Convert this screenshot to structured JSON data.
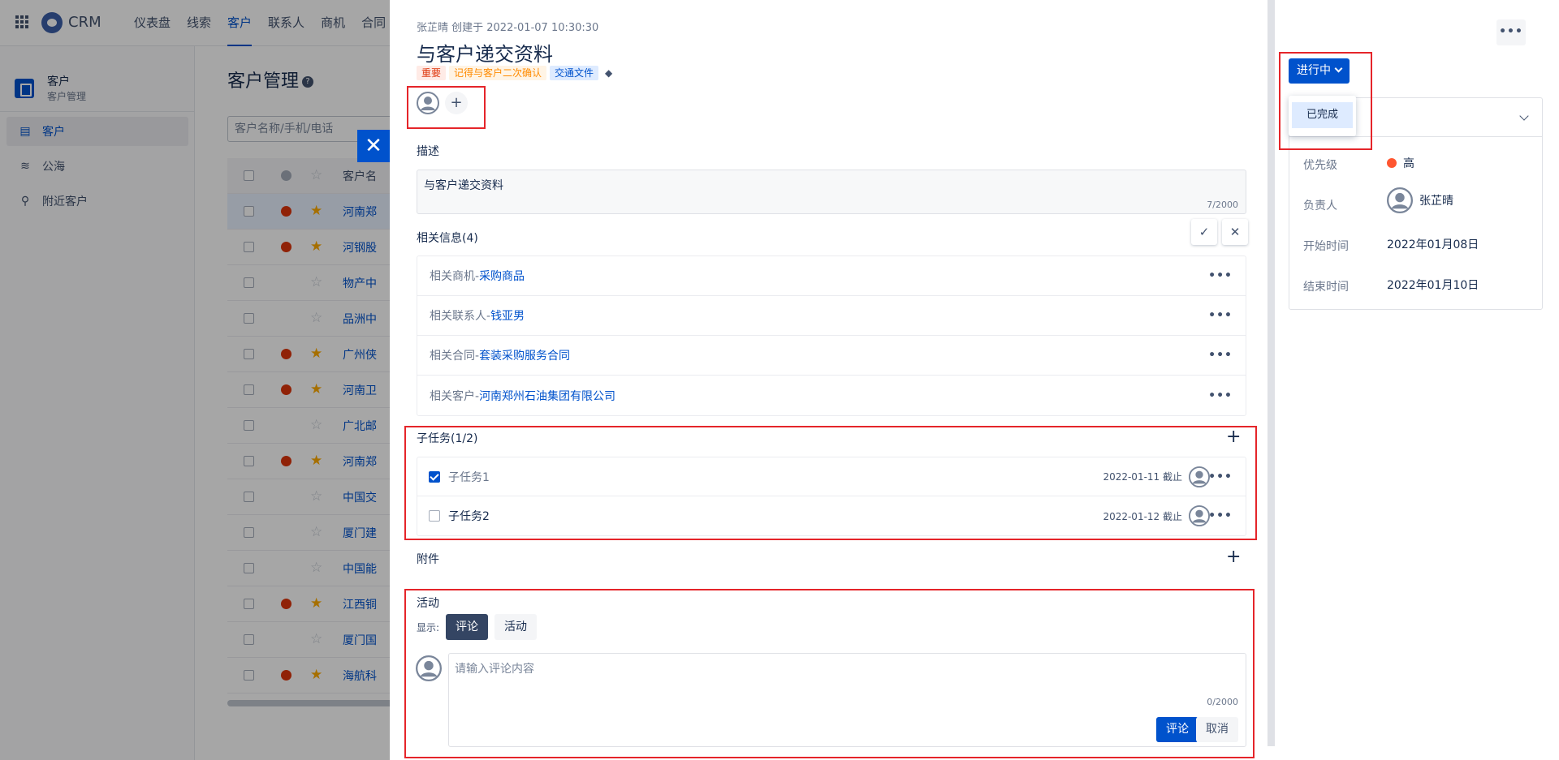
{
  "app": {
    "brand": "CRM",
    "nav": [
      "仪表盘",
      "线索",
      "客户",
      "联系人",
      "商机",
      "合同"
    ],
    "active_nav": 2
  },
  "sidebar": {
    "module_title": "客户",
    "module_subtitle": "客户管理",
    "items": [
      {
        "label": "客户",
        "icon": "building-icon"
      },
      {
        "label": "公海",
        "icon": "waves-icon"
      },
      {
        "label": "附近客户",
        "icon": "location-pin-icon"
      }
    ]
  },
  "main": {
    "title": "客户管理",
    "search_placeholder": "客户名称/手机/电话",
    "name_header": "客户名",
    "rows": [
      {
        "name": "河南郑",
        "dot": true,
        "star": true,
        "selected": true
      },
      {
        "name": "河钢股",
        "dot": true,
        "star": true
      },
      {
        "name": "物产中",
        "dot": false,
        "star": false
      },
      {
        "name": "品洲中",
        "dot": false,
        "star": false
      },
      {
        "name": "广州侠",
        "dot": true,
        "star": true
      },
      {
        "name": "河南卫",
        "dot": true,
        "star": true
      },
      {
        "name": "广北邮",
        "dot": false,
        "star": false
      },
      {
        "name": "河南郑",
        "dot": true,
        "star": true
      },
      {
        "name": "中国交",
        "dot": false,
        "star": false
      },
      {
        "name": "厦门建",
        "dot": false,
        "star": false
      },
      {
        "name": "中国能",
        "dot": false,
        "star": false
      },
      {
        "name": "江西铜",
        "dot": true,
        "star": true
      },
      {
        "name": "厦门国",
        "dot": false,
        "star": false
      },
      {
        "name": "海航科",
        "dot": true,
        "star": true
      }
    ]
  },
  "task": {
    "meta": "张芷晴 创建于 2022-01-07 10:30:30",
    "title": "与客户递交资料",
    "tags": [
      {
        "label": "重要",
        "style": "red"
      },
      {
        "label": "记得与客户二次确认",
        "style": "orange"
      },
      {
        "label": "交通文件",
        "style": "blue"
      }
    ],
    "description_label": "描述",
    "description": "与客户递交资料",
    "description_count": "7/2000",
    "related_label": "相关信息(4)",
    "related": [
      {
        "key": "相关商机-",
        "value": "采购商品"
      },
      {
        "key": "相关联系人-",
        "value": "钱亚男"
      },
      {
        "key": "相关合同-",
        "value": "套装采购服务合同"
      },
      {
        "key": "相关客户-",
        "value": "河南郑州石油集团有限公司"
      }
    ],
    "subtasks_label": "子任务(1/2)",
    "subtasks": [
      {
        "name": "子任务1",
        "due": "2022-01-11 截止",
        "done": true
      },
      {
        "name": "子任务2",
        "due": "2022-01-12 截止",
        "done": false
      }
    ],
    "attachments_label": "附件",
    "activity_label": "活动",
    "show_label": "显示:",
    "activity_tabs": [
      "评论",
      "活动"
    ],
    "comment_placeholder": "请输入评论内容",
    "comment_count": "0/2000",
    "comment_submit": "评论",
    "comment_cancel": "取消"
  },
  "panel": {
    "more": "•••",
    "status": "进行中",
    "status_options": [
      "已完成"
    ],
    "fields": [
      {
        "label": "优先级",
        "value": "高"
      },
      {
        "label": "负责人",
        "value": "张芷晴"
      },
      {
        "label": "开始时间",
        "value": "2022年01月08日"
      },
      {
        "label": "结束时间",
        "value": "2022年01月10日"
      }
    ],
    "priority_color": "#ff5630",
    "accent_color": "#0052cc"
  }
}
